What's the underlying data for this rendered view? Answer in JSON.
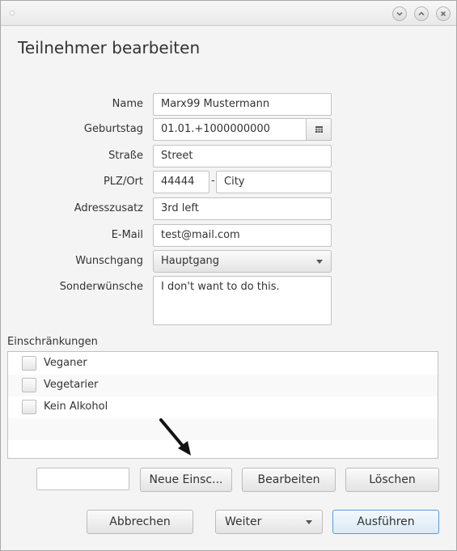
{
  "dialog": {
    "title": "Teilnehmer bearbeiten"
  },
  "form": {
    "name": {
      "label": "Name",
      "value": "Marx99 Mustermann"
    },
    "birthday": {
      "label": "Geburtstag",
      "value": "01.01.+1000000000"
    },
    "street": {
      "label": "Straße",
      "value": "Street"
    },
    "plz_ort": {
      "label": "PLZ/Ort",
      "plz": "44444",
      "separator": "-",
      "city": "City"
    },
    "address_extra": {
      "label": "Adresszusatz",
      "value": "3rd left"
    },
    "email": {
      "label": "E-Mail",
      "value": "test@mail.com"
    },
    "course_wish": {
      "label": "Wunschgang",
      "value": "Hauptgang"
    },
    "special_wishes": {
      "label": "Sonderwünsche",
      "value": "I don't want to do this."
    }
  },
  "restrictions": {
    "label": "Einschränkungen",
    "items": [
      {
        "label": "Veganer",
        "checked": false
      },
      {
        "label": "Vegetarier",
        "checked": false
      },
      {
        "label": "Kein Alkohol",
        "checked": false
      }
    ],
    "new_input": "",
    "new_button": "Neue Einsc...",
    "edit_button": "Bearbeiten",
    "delete_button": "Löschen"
  },
  "footer": {
    "cancel": "Abbrechen",
    "next": "Weiter",
    "execute": "Ausführen"
  },
  "icons": {
    "window_minimize": "chevron-down-icon",
    "window_maximize": "chevron-up-icon",
    "window_close": "close-icon",
    "calendar": "calendar-icon",
    "annotation": "arrow-icon"
  },
  "colors": {
    "primary_border": "#5a9bd5",
    "window_bg": "#f4f4f4"
  }
}
